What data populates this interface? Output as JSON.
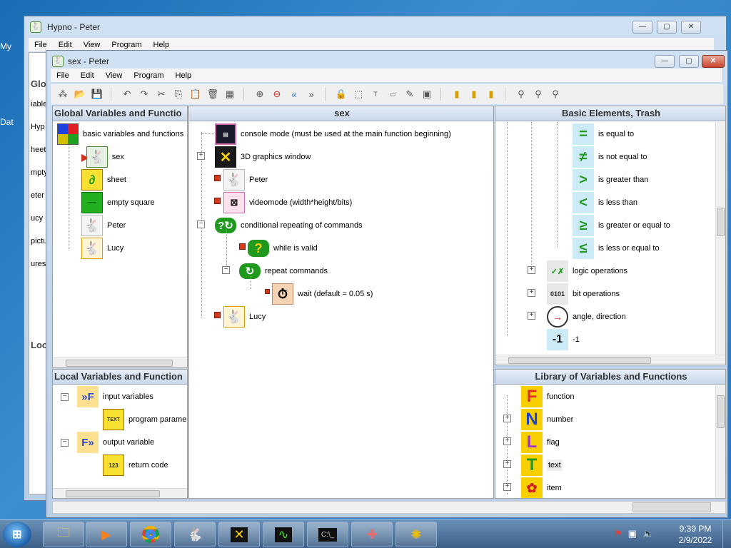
{
  "desktop": {
    "icon_labels": [
      "My",
      "Dat"
    ]
  },
  "back_window": {
    "title": "Hypno - Peter",
    "menu": [
      "File",
      "Edit",
      "View",
      "Program",
      "Help"
    ],
    "side_texts": [
      "Glo",
      "iable",
      "Hyp",
      "heet",
      "mpty",
      "eter",
      "ucy",
      "pictu",
      "ures",
      "Loc"
    ]
  },
  "front_window": {
    "title": "sex - Peter",
    "menu": [
      "File",
      "Edit",
      "View",
      "Program",
      "Help"
    ]
  },
  "global_panel": {
    "header": "Global Variables and Functio",
    "items": [
      {
        "label": "basic variables and functions",
        "icon": "grid-icon"
      },
      {
        "label": "sex",
        "icon": "bunny-icon"
      },
      {
        "label": "sheet",
        "icon": "sheet-icon"
      },
      {
        "label": "empty square",
        "icon": "square-icon"
      },
      {
        "label": "Peter",
        "icon": "bunny-icon"
      },
      {
        "label": "Lucy",
        "icon": "bunny-icon"
      }
    ]
  },
  "local_panel": {
    "header": "Local Variables and Function",
    "items": [
      {
        "label": "input variables"
      },
      {
        "label": "program parame"
      },
      {
        "label": "output variable"
      },
      {
        "label": "return code"
      }
    ],
    "icon_text": {
      "program_params": "TEXT",
      "return_code": "123"
    }
  },
  "sex_panel": {
    "header": "sex",
    "items": [
      {
        "label": "console mode (must be used at the main function beginning)"
      },
      {
        "label": "3D graphics window"
      },
      {
        "label": "Peter"
      },
      {
        "label": "videomode (width*height/bits)"
      },
      {
        "label": "conditional repeating of commands"
      },
      {
        "label": "while is valid"
      },
      {
        "label": "repeat commands"
      },
      {
        "label": "wait (default = 0.05 s)"
      },
      {
        "label": "Lucy"
      }
    ]
  },
  "basic_panel": {
    "header": "Basic Elements, Trash",
    "items": [
      {
        "label": "is equal to",
        "symbol": "="
      },
      {
        "label": "is not equal to",
        "symbol": "≠"
      },
      {
        "label": "is greater than",
        "symbol": ">"
      },
      {
        "label": "is less than",
        "symbol": "<"
      },
      {
        "label": "is greater or equal to",
        "symbol": "≥"
      },
      {
        "label": "is less or equal to",
        "symbol": "≤"
      },
      {
        "label": "logic operations",
        "symbol": "✓✗"
      },
      {
        "label": "bit operations",
        "symbol": "0101"
      },
      {
        "label": "angle, direction",
        "symbol": "→"
      },
      {
        "label": "-1",
        "symbol": "-1"
      }
    ]
  },
  "library_panel": {
    "header": "Library of Variables and Functions",
    "items": [
      {
        "label": "function",
        "letter": "F"
      },
      {
        "label": "number",
        "letter": "N"
      },
      {
        "label": "flag",
        "letter": "L"
      },
      {
        "label": "text",
        "letter": "T"
      },
      {
        "label": "item",
        "letter": "✿"
      }
    ]
  },
  "taskbar": {
    "time": "9:39 PM",
    "date": "2/9/2022"
  },
  "colors": {
    "accent": "#3d8fd1",
    "mark": "#d43b1d",
    "green": "#1f9a1f"
  }
}
